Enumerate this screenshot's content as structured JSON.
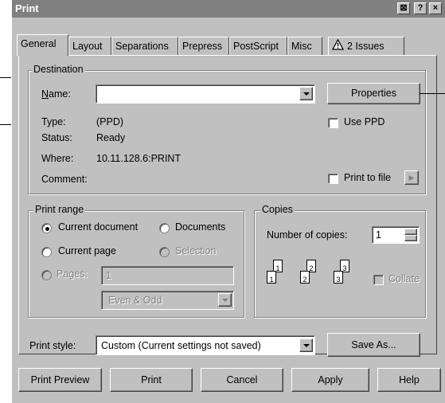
{
  "window": {
    "title": "Print"
  },
  "titlebar_buttons": [
    "⊠",
    "?",
    "×"
  ],
  "tabs": [
    {
      "label": "General"
    },
    {
      "label": "Layout"
    },
    {
      "label": "Separations"
    },
    {
      "label": "Prepress"
    },
    {
      "label": "PostScript"
    },
    {
      "label": "Misc"
    },
    {
      "label": "2 Issues"
    }
  ],
  "destination": {
    "legend": "Destination",
    "name_label": "Name:",
    "name_value": "",
    "properties_button": "Properties",
    "type_label": "Type:",
    "type_value": "(PPD)",
    "status_label": "Status:",
    "status_value": "Ready",
    "where_label": "Where:",
    "where_value": "10.11.128.6:PRINT",
    "comment_label": "Comment:",
    "use_ppd_label": "Use PPD",
    "print_to_file_label": "Print to file",
    "print_to_file_arrow": "▶"
  },
  "print_range": {
    "legend": "Print range",
    "current_document": "Current document",
    "documents": "Documents",
    "current_page": "Current page",
    "selection": "Selection",
    "pages": "Pages:",
    "pages_value": "1",
    "even_odd": "Even & Odd"
  },
  "copies": {
    "legend": "Copies",
    "number_label": "Number of copies:",
    "number_value": "1",
    "collate_label": "Collate",
    "page_labels": [
      "1",
      "1",
      "2",
      "2",
      "3",
      "3"
    ]
  },
  "print_style": {
    "label": "Print style:",
    "value": "Custom (Current settings not saved)",
    "save_as": "Save As..."
  },
  "footer": {
    "print_preview": "Print Preview",
    "print": "Print",
    "cancel": "Cancel",
    "apply": "Apply",
    "help": "Help"
  }
}
